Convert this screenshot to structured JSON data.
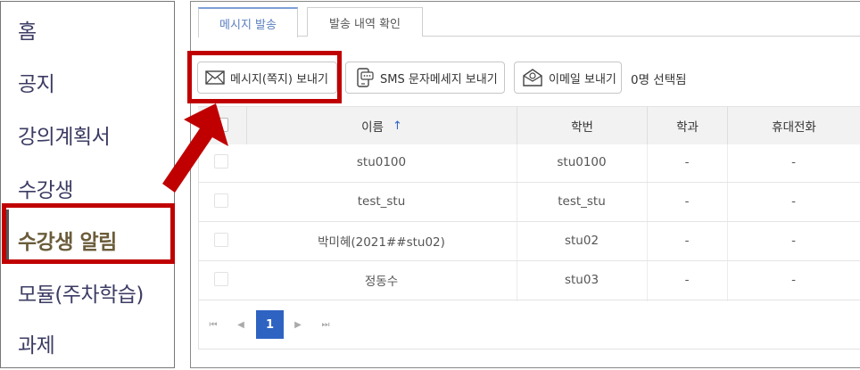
{
  "sidebar": {
    "items": [
      {
        "label": "홈"
      },
      {
        "label": "공지"
      },
      {
        "label": "강의계획서"
      },
      {
        "label": "수강생"
      },
      {
        "label": "수강생 알림"
      },
      {
        "label": "모듈(주차학습)"
      },
      {
        "label": "과제"
      }
    ],
    "active_index": 4
  },
  "tabs": [
    {
      "label": "메시지 발송",
      "active": true
    },
    {
      "label": "발송 내역 확인",
      "active": false
    }
  ],
  "toolbar": {
    "message_button": "메시지(쪽지) 보내기",
    "sms_button": "SMS 문자메세지 보내기",
    "email_button": "이메일 보내기",
    "selected_count": "0명 선택됨",
    "icons": [
      "envelope-icon",
      "phone-icon",
      "email-icon"
    ]
  },
  "table": {
    "columns": [
      "이름",
      "학번",
      "학과",
      "휴대전화"
    ],
    "sort_indicator": "↑",
    "rows": [
      {
        "name": "stu0100",
        "id": "stu0100",
        "dept": "-",
        "phone": "-"
      },
      {
        "name": "test_stu",
        "id": "test_stu",
        "dept": "-",
        "phone": "-"
      },
      {
        "name": "박미혜(2021##stu02)",
        "id": "stu02",
        "dept": "-",
        "phone": "-"
      },
      {
        "name": "정동수",
        "id": "stu03",
        "dept": "-",
        "phone": "-"
      }
    ]
  },
  "pagination": {
    "first": "⏮",
    "prev": "◀",
    "current_page": "1",
    "next": "▶",
    "last": "⏭"
  },
  "colors": {
    "highlight": "#c00000",
    "accent_blue": "#2e63c2",
    "tab_active": "#5b7fbf"
  }
}
